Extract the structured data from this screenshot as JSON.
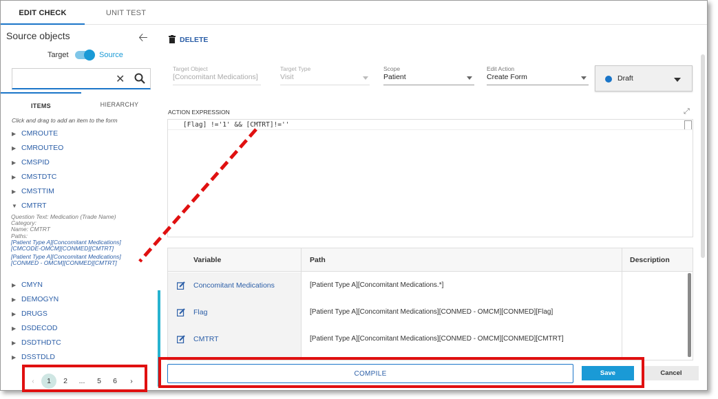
{
  "tabs": [
    {
      "label": "EDIT CHECK",
      "active": true
    },
    {
      "label": "UNIT TEST",
      "active": false
    }
  ],
  "source": {
    "title": "Source objects",
    "toggle_left": "Target",
    "toggle_right": "Source",
    "toggle_on": true,
    "search_placeholder": "",
    "subtabs": [
      "ITEMS",
      "HIERARCHY"
    ],
    "hint": "Click and drag to add an item to the form",
    "items": [
      "CMROUTE",
      "CMROUTEO",
      "CMSPID",
      "CMSTDTC",
      "CMSTTIM",
      "CMTRT",
      "CMYN",
      "DEMOGYN",
      "DRUGS",
      "DSDECOD",
      "DSDTHDTC",
      "DSSTDLD"
    ],
    "expanded_item": "CMTRT",
    "details": {
      "question": "Question Text: Medication (Trade Name)",
      "category": "Category:",
      "name": "Name: CMTRT",
      "paths_label": "Paths:",
      "paths": [
        "[Patient Type A][Concomitant Medications]",
        "[CMCODE-OMCM][CONMED][CMTRT]",
        "[Patient Type A][Concomitant Medications]",
        "[CONMED - OMCM][CONMED][CMTRT]"
      ]
    },
    "pager": {
      "prev": "‹",
      "pages": [
        "1",
        "2",
        "...",
        "5",
        "6"
      ],
      "next": "›",
      "current": "1"
    }
  },
  "toolbar": {
    "delete_label": "DELETE"
  },
  "fields": {
    "target_object": {
      "label": "Target Object",
      "value": "[Concomitant Medications]",
      "disabled": true
    },
    "target_type": {
      "label": "Target Type",
      "value": "Visit",
      "disabled": true
    },
    "scope": {
      "label": "Scope",
      "value": "Patient"
    },
    "edit_action": {
      "label": "Edit Action",
      "value": "Create Form"
    },
    "status": "Draft"
  },
  "expression": {
    "label": "ACTION EXPRESSION",
    "text": "[Flag] !='1' && [CMTRT]!=''"
  },
  "variables": {
    "headers": [
      "Variable",
      "Path",
      "Description"
    ],
    "rows": [
      {
        "name": "Concomitant Medications",
        "path": "[Patient Type A][Concomitant Medications.*]",
        "description": ""
      },
      {
        "name": "Flag",
        "path": "[Patient Type A][Concomitant Medications][CONMED - OMCM][CONMED][Flag]",
        "description": ""
      },
      {
        "name": "CMTRT",
        "path": "[Patient Type A][Concomitant Medications][CONMED - OMCM][CONMED][CMTRT]",
        "description": ""
      }
    ]
  },
  "actions": {
    "compile": "COMPILE",
    "save": "Save",
    "cancel": "Cancel"
  },
  "colors": {
    "accent": "#1a75c8",
    "link": "#2b5ea7",
    "save": "#1a9ad6",
    "annotation": "#e01010"
  }
}
